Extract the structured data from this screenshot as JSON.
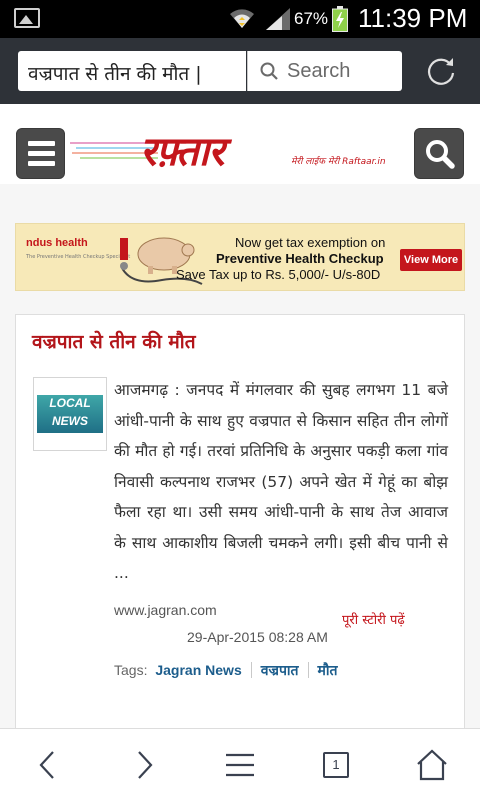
{
  "status_bar": {
    "battery_percent": "67%",
    "time": "11:39 PM",
    "icons": [
      "image-notification-icon",
      "wifi-icon",
      "signal-icon",
      "battery-charging-icon"
    ]
  },
  "browser": {
    "url_text": "वज्रपात से तीन की मौत |",
    "search_placeholder": "Search",
    "icons": [
      "search-icon",
      "refresh-icon"
    ]
  },
  "site": {
    "logo_text": "रफ़्तार",
    "logo_tagline": "मेरी लाईफ मेरी Raftaar.in",
    "icons": [
      "menu-icon",
      "site-search-icon"
    ]
  },
  "ad": {
    "brand": "ndus health",
    "brand_sub": "The Preventive Health Checkup Specialist",
    "line1": "Now get tax exemption on",
    "line2": "Preventive Health Checkup",
    "line3": "Save Tax up to Rs. 5,000/- U/s-80D",
    "cta": "View More"
  },
  "article": {
    "title": "वज्रपात से तीन की मौत",
    "thumbnail": {
      "line1": "LOCAL",
      "line2": "NEWS"
    },
    "body": "आजमगढ़ : जनपद में मंगलवार की सुबह लगभग 11 बजे आंधी-पानी के साथ हुए वज्रपात से किसान सहित तीन लोगों की मौत हो गई। तरवां प्रतिनिधि के अनुसार पकड़ी कला गांव निवासी कल्पनाथ राजभर (57) अपने खेत में गेहूं का बोझ फैला रहा था। उसी समय आंधी-पानी के साथ तेज आवाज के साथ आकाशीय बिजली चमकने लगी। इसी बीच पानी से ...",
    "source": "www.jagran.com",
    "read_more": "पूरी स्टोरी पढ़ें",
    "date": "29-Apr-2015 08:28 AM",
    "tags_label": "Tags:",
    "tags": [
      "Jagran News",
      "वज्रपात",
      "मौत"
    ]
  },
  "bottom_bar": {
    "tab_count": "1",
    "icons": [
      "back-icon",
      "forward-icon",
      "menu-icon",
      "tabs-icon",
      "home-icon"
    ]
  },
  "colors": {
    "brand_red": "#c4161c",
    "title_red": "#b3151a",
    "tag_blue": "#1c5d8c",
    "address_bar": "#2e3238"
  }
}
